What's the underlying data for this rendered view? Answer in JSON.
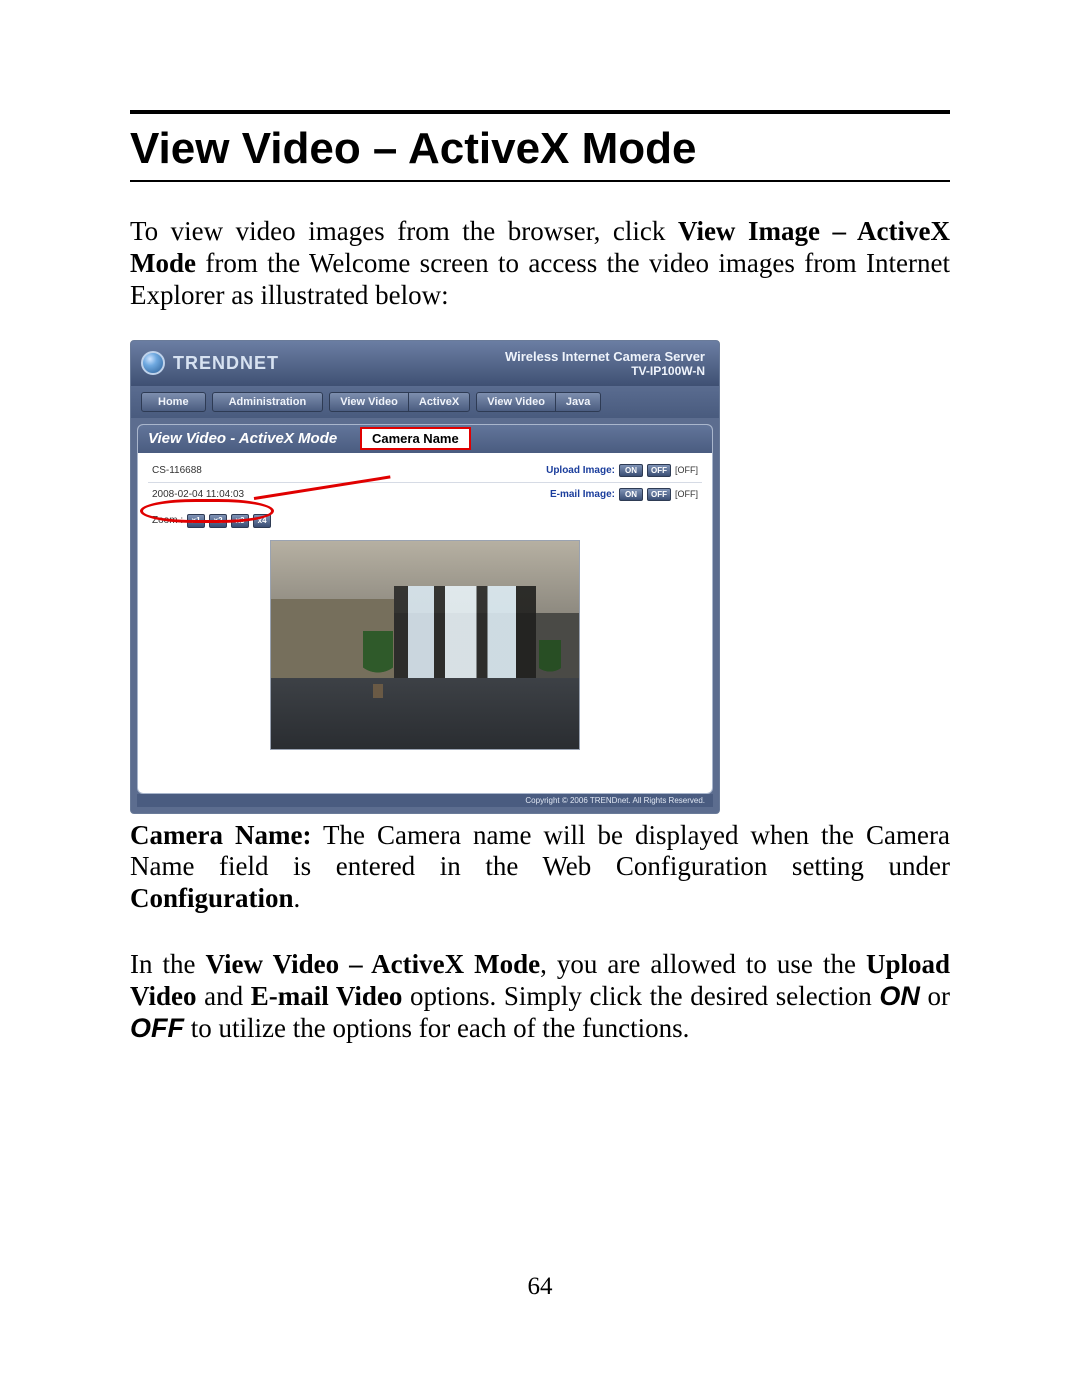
{
  "doc": {
    "title": "View Video – ActiveX Mode",
    "page_number": "64",
    "para1_a": "To view video images from the browser, click ",
    "para1_bold": "View Image – ActiveX Mode",
    "para1_b": " from the Welcome screen to access the video images from Internet Explorer as illustrated below:",
    "para2_lead_bold": "Camera Name:",
    "para2_a": " The Camera name will be displayed when the Camera Name field is entered in the Web Configuration setting under ",
    "para2_bold2": "Configuration",
    "para2_b": ".",
    "para3_a": "In the ",
    "para3_bold1": "View Video – ActiveX Mode",
    "para3_b": ", you are allowed to use the ",
    "para3_bold2": "Upload Video",
    "para3_c": " and ",
    "para3_bold3": "E-mail Video",
    "para3_d": " options.  Simply click the desired selection ",
    "para3_bi_on": "ON",
    "para3_e": " or ",
    "para3_bi_off": "OFF",
    "para3_f": " to utilize the options for each of the functions."
  },
  "shot": {
    "brand": "TRENDNET",
    "header_line1": "Wireless Internet Camera Server",
    "header_line2": "TV-IP100W-N",
    "nav": {
      "home": "Home",
      "admin": "Administration",
      "view_activex_a": "View Video",
      "view_activex_b": "ActiveX",
      "view_java_a": "View Video",
      "view_java_b": "Java"
    },
    "panel_title": "View Video - ActiveX Mode",
    "callout": "Camera Name",
    "camera_name": "CS-116688",
    "timestamp": "2008-02-04 11:04:03",
    "upload_label": "Upload Image:",
    "email_label": "E-mail Image:",
    "on": "ON",
    "off": "OFF",
    "state_off": "[OFF]",
    "zoom_label": "Zoom :",
    "zoom": [
      "x1",
      "x2",
      "x3",
      "x4"
    ],
    "copyright": "Copyright © 2006 TRENDnet. All Rights Reserved."
  }
}
